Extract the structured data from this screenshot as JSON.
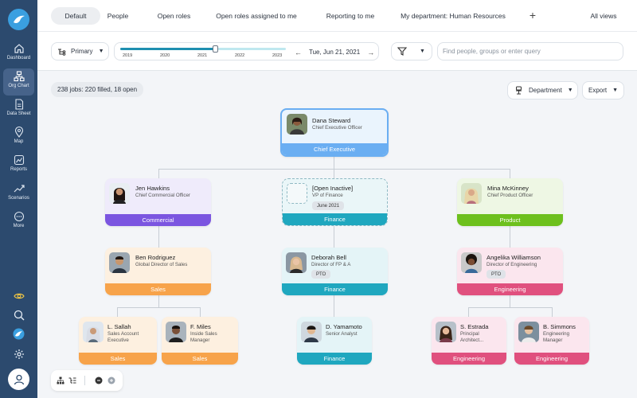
{
  "sidebar": {
    "items": [
      {
        "label": "Dashboard",
        "icon": "home-icon"
      },
      {
        "label": "Org Chart",
        "icon": "org-chart-icon"
      },
      {
        "label": "Data Sheet",
        "icon": "data-sheet-icon"
      },
      {
        "label": "Map",
        "icon": "map-pin-icon"
      },
      {
        "label": "Reports",
        "icon": "reports-icon"
      },
      {
        "label": "Scenarios",
        "icon": "scenarios-icon"
      },
      {
        "label": "More",
        "icon": "more-icon"
      }
    ],
    "active": "Org Chart"
  },
  "tabs": [
    {
      "label": "Default"
    },
    {
      "label": "People"
    },
    {
      "label": "Open roles"
    },
    {
      "label": "Open roles assigned to me"
    },
    {
      "label": "Reporting to me"
    },
    {
      "label": "My department: Human Resources"
    }
  ],
  "tabs_add": "+",
  "all_views": "All views",
  "toolbar": {
    "primary_label": "Primary",
    "years": [
      "2019",
      "2020",
      "2021",
      "2022",
      "2023"
    ],
    "date": "Tue, Jun 21, 2021",
    "search_placeholder": "Find people, groups or enter query"
  },
  "main": {
    "jobs_summary": "238 jobs: 220 filled, 18 open",
    "department_label": "Department",
    "export_label": "Export"
  },
  "colors": {
    "executive": "#6aaef2",
    "commercial": "#7b55e0",
    "finance": "#1fa7bf",
    "product": "#6dc01d",
    "sales": "#f7a34a",
    "engineering": "#e0507e"
  },
  "cards": {
    "ceo": {
      "name": "Dana Steward",
      "title": "Chief Executive Officer",
      "dept": "Chief Executive"
    },
    "jen": {
      "name": "Jen Hawkins",
      "title": "Chief Commercial Officer",
      "dept": "Commercial"
    },
    "open": {
      "name": "[Open Inactive]",
      "title": "VP of Finance",
      "tag": "June 2021",
      "dept": "Finance"
    },
    "mina": {
      "name": "Mina McKinney",
      "title": "Chief Product Officer",
      "dept": "Product"
    },
    "ben": {
      "name": "Ben Rodriguez",
      "title": "Global Director of Sales",
      "dept": "Sales"
    },
    "deborah": {
      "name": "Deborah Bell",
      "title": "Director of FP & A",
      "tag": "PTO",
      "dept": "Finance"
    },
    "angelika": {
      "name": "Angelika Williamson",
      "title": "Director of Engineering",
      "tag": "PTO",
      "dept": "Engineering"
    },
    "sallah": {
      "name": "L. Sallah",
      "title": "Sales Account Executive",
      "dept": "Sales"
    },
    "miles": {
      "name": "F. Miles",
      "title": "Inside Sales Manager",
      "dept": "Sales"
    },
    "yamamoto": {
      "name": "D. Yamamoto",
      "title": "Senior Analyst",
      "dept": "Finance"
    },
    "estrada": {
      "name": "S. Estrada",
      "title": "Principal Architect...",
      "dept": "Engineering"
    },
    "simmons": {
      "name": "B. Simmons",
      "title": "Engineering Manager",
      "dept": "Engineering"
    }
  }
}
